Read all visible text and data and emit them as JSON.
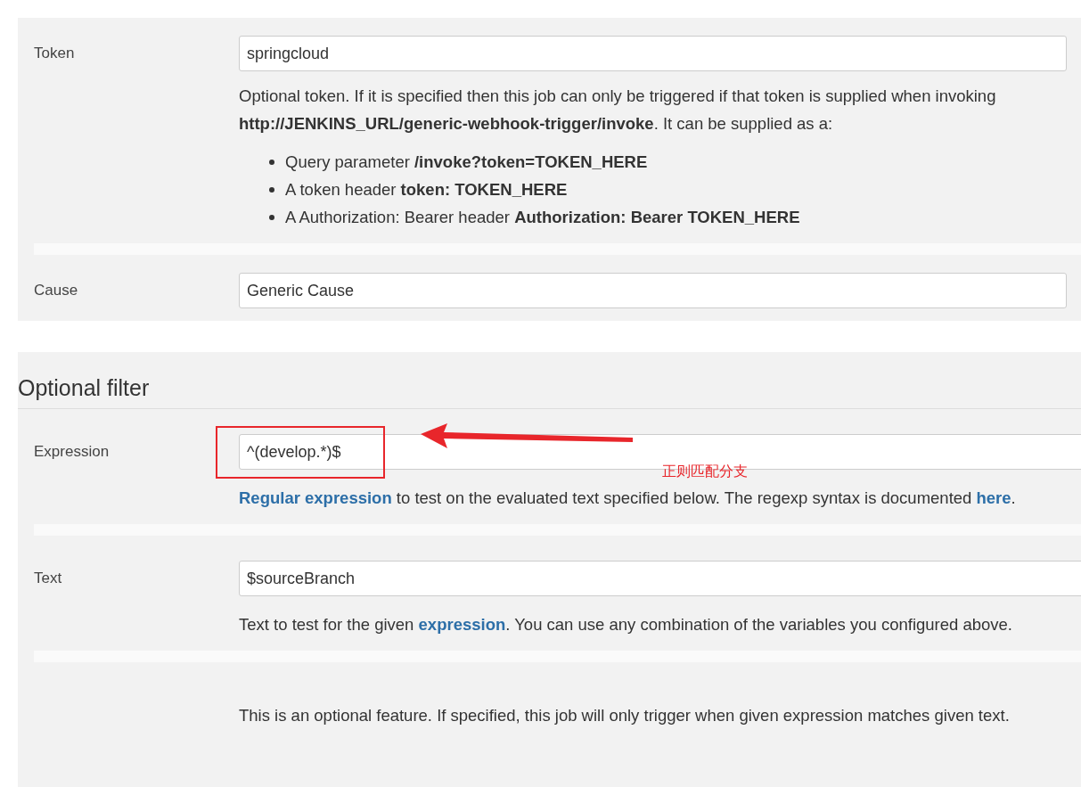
{
  "sections": [
    {
      "rows": [
        {
          "label": "Token",
          "value": "springcloud",
          "help": [
            {
              "kind": "plain",
              "text": "Optional token. If it is specified then this job can only be triggered if that token is supplied when invoking **http://JENKINS_URL/generic-webhook-trigger/invoke**. It can be supplied as a:"
            }
          ],
          "bullets": [
            "Query parameter **/invoke?token=TOKEN_HERE**",
            "A token header **token: TOKEN_HERE**",
            "A Authorization: Bearer header **Authorization: Bearer TOKEN_HERE**"
          ]
        },
        {
          "label": "Cause",
          "value": "Generic Cause"
        }
      ]
    },
    {
      "heading": "Optional filter",
      "annotation": "正则匹配分支",
      "rows": [
        {
          "label": "Expression",
          "value": "^(develop.*)$",
          "help": [
            {
              "kind": "link",
              "text": "Regular expression"
            },
            {
              "kind": "plain",
              "text": " to test on the evaluated text specified below. The regexp syntax is documented "
            },
            {
              "kind": "link",
              "text": "here"
            },
            {
              "kind": "plain",
              "text": "."
            }
          ]
        },
        {
          "label": "Text",
          "value": "$sourceBranch",
          "help": [
            {
              "kind": "plain",
              "text": "Text to test for the given "
            },
            {
              "kind": "link",
              "text": "expression"
            },
            {
              "kind": "plain",
              "text": ". You can use any combination of the variables you configured above."
            }
          ]
        },
        {
          "help": [
            {
              "kind": "plain",
              "text": "This is an optional feature. If specified, this job will only trigger when given expression matches given text."
            }
          ]
        }
      ]
    }
  ]
}
